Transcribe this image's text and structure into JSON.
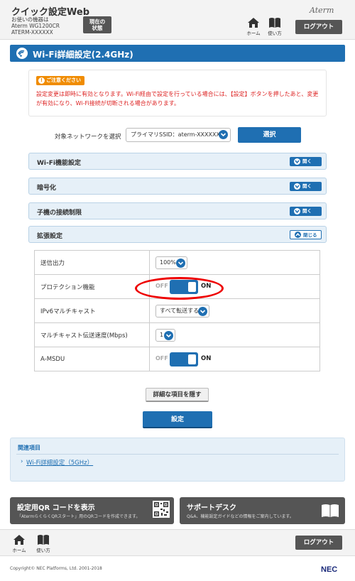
{
  "header": {
    "app_title": "クイック設定Web",
    "device_label": "お使いの機器は",
    "device_model": "Aterm WG1200CR",
    "device_ssid": "ATERM-XXXXXX",
    "status_line1": "現在の",
    "status_line2": "状態",
    "brand": "Aterm",
    "home_label": "ホーム",
    "guide_label": "使い方",
    "logout_label": "ログアウト"
  },
  "page_title": "Wi-Fi詳細設定(2.4GHz)",
  "caution": {
    "badge": "ご注意ください",
    "text": "設定変更は即時に有効となります。Wi-Fi経由で設定を行っている場合には、【設定】ボタンを押したあと、変更が有効になり、Wi-Fi接続が切断される場合があります。"
  },
  "network": {
    "label": "対象ネットワークを選択",
    "selected": "プライマリSSID：aterm-XXXXXX-g",
    "select_button": "選択"
  },
  "sections": [
    {
      "label": "Wi-Fi機能設定",
      "toggle": "開く"
    },
    {
      "label": "暗号化",
      "toggle": "開く"
    },
    {
      "label": "子機の接続制限",
      "toggle": "開く"
    },
    {
      "label": "拡張設定",
      "toggle": "閉じる"
    }
  ],
  "settings": [
    {
      "label": "送信出力",
      "value": "100%"
    },
    {
      "label": "プロテクション機能",
      "off": "OFF",
      "on": "ON",
      "state": "on"
    },
    {
      "label": "IPv6マルチキャスト",
      "value": "すべて転送する"
    },
    {
      "label": "マルチキャスト伝送速度(Mbps)",
      "value": "1"
    },
    {
      "label": "A-MSDU",
      "off": "OFF",
      "on": "ON",
      "state": "on"
    }
  ],
  "buttons": {
    "hide_details": "詳細な項目を隠す",
    "save": "設定"
  },
  "related": {
    "header": "関連項目",
    "link": "Wi-Fi詳細設定（5GHz）"
  },
  "panels": {
    "qr_title": "設定用QR コードを表示",
    "qr_sub": "「AtermらくらくQRスタート」用のQRコードを作成できます。",
    "support_title": "サポートデスク",
    "support_sub": "Q&A、機能設定ガイドなどの情報をご案内しています。"
  },
  "footer": {
    "home_label": "ホーム",
    "guide_label": "使い方",
    "logout_label": "ログアウト",
    "copyright": "Copyright© NEC Platforms, Ltd. 2001-2018",
    "nec": "NEC"
  },
  "colors": {
    "accent": "#1f6fb2",
    "caution": "#f08c00",
    "warning_text": "#dd2222",
    "highlight": "#ee0000"
  }
}
